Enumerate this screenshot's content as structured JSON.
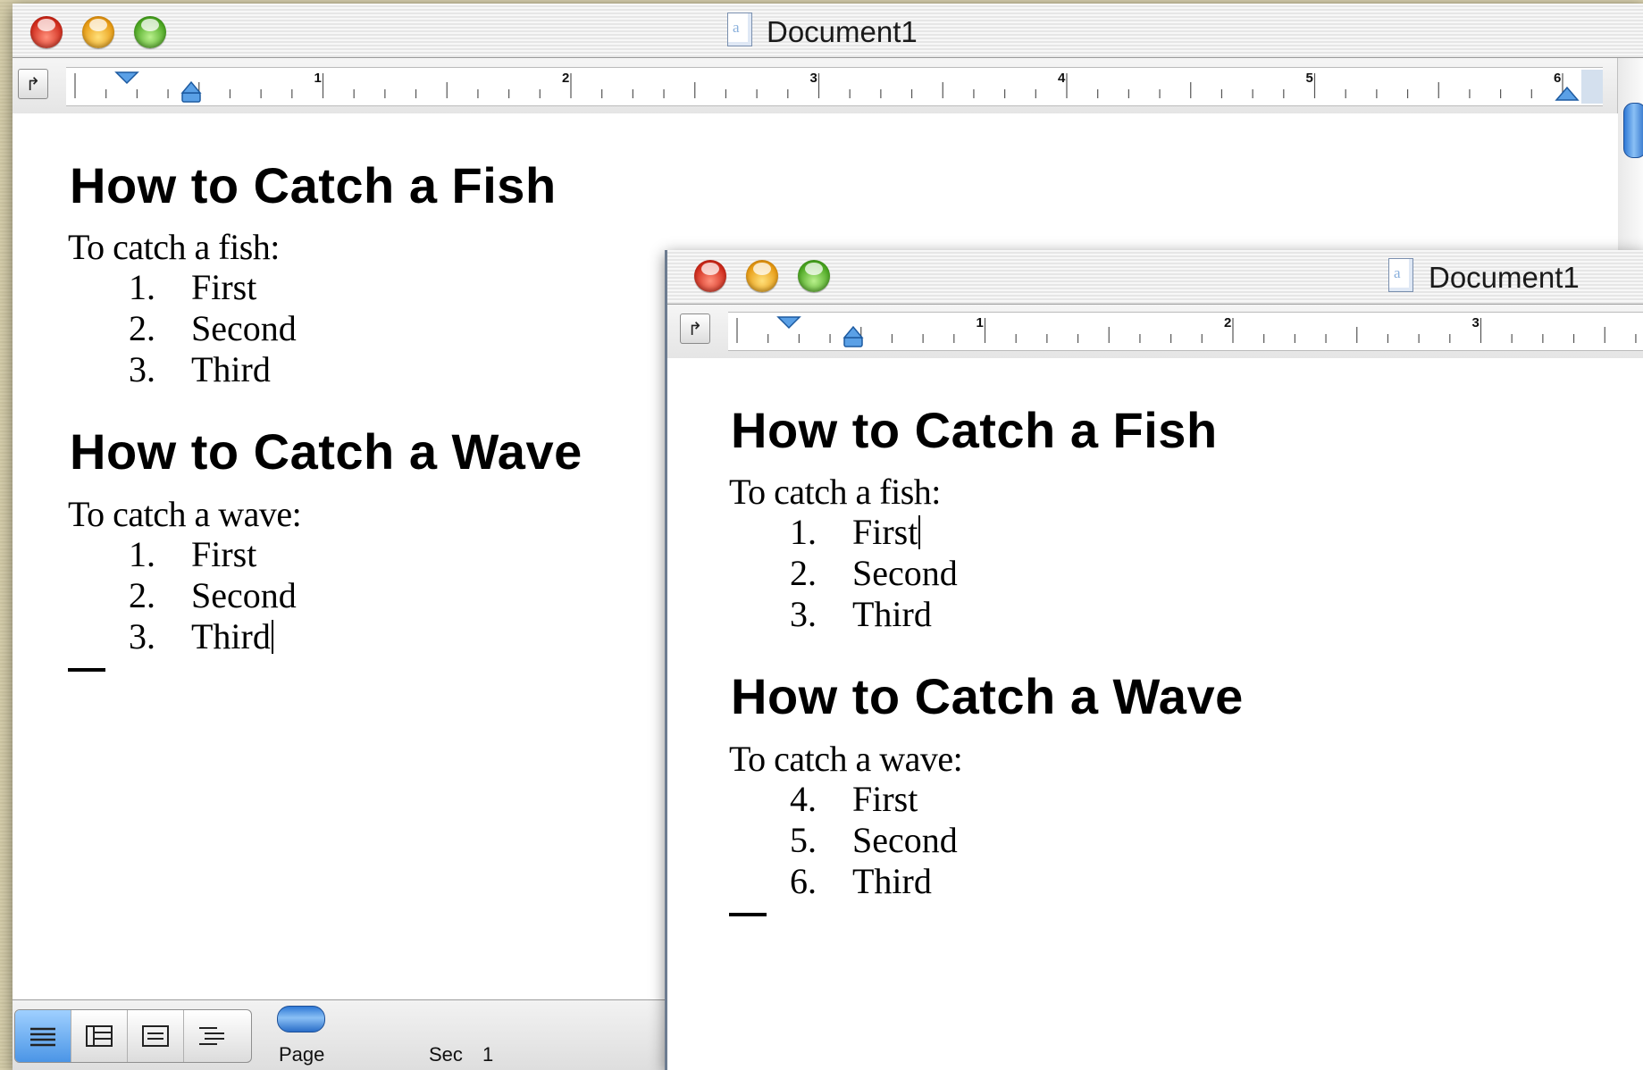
{
  "back_window": {
    "title": "Document1",
    "ruler_numbers": [
      "1",
      "2",
      "3",
      "4",
      "5",
      "6"
    ],
    "sections": [
      {
        "heading": "How to Catch a Fish",
        "intro": "To catch a fish:",
        "items": [
          {
            "number": "1.",
            "text": "First"
          },
          {
            "number": "2.",
            "text": "Second"
          },
          {
            "number": "3.",
            "text": "Third"
          }
        ]
      },
      {
        "heading": "How to Catch a Wave",
        "intro": "To catch a wave:",
        "items": [
          {
            "number": "1.",
            "text": "First"
          },
          {
            "number": "2.",
            "text": "Second"
          },
          {
            "number": "3.",
            "text": "Third"
          }
        ]
      }
    ],
    "status": {
      "page_label": "Page",
      "sec_label": "Sec",
      "sec_value": "1"
    }
  },
  "front_window": {
    "title": "Document1",
    "ruler_numbers": [
      "1",
      "2",
      "3"
    ],
    "sections": [
      {
        "heading": "How to Catch a Fish",
        "intro": "To catch a fish:",
        "items": [
          {
            "number": "1.",
            "text": "First"
          },
          {
            "number": "2.",
            "text": "Second"
          },
          {
            "number": "3.",
            "text": "Third"
          }
        ]
      },
      {
        "heading": "How to Catch a Wave",
        "intro": "To catch a wave:",
        "items": [
          {
            "number": "4.",
            "text": "First"
          },
          {
            "number": "5.",
            "text": "Second"
          },
          {
            "number": "6.",
            "text": "Third"
          }
        ]
      }
    ]
  },
  "icons": {
    "close": "close-button-icon",
    "minimize": "minimize-button-icon",
    "zoom": "zoom-button-icon",
    "document": "document-icon",
    "tab_stop": "tab-stop-icon",
    "normal_view": "normal-view-icon",
    "online_layout": "online-layout-view-icon",
    "page_layout": "page-layout-view-icon",
    "outline_view": "outline-view-icon"
  },
  "colors": {
    "desktop": "#d6ceaa",
    "accent": "#2f79d6",
    "close": "#d02a1b",
    "minimize": "#e79a12",
    "zoom": "#4aa620"
  }
}
